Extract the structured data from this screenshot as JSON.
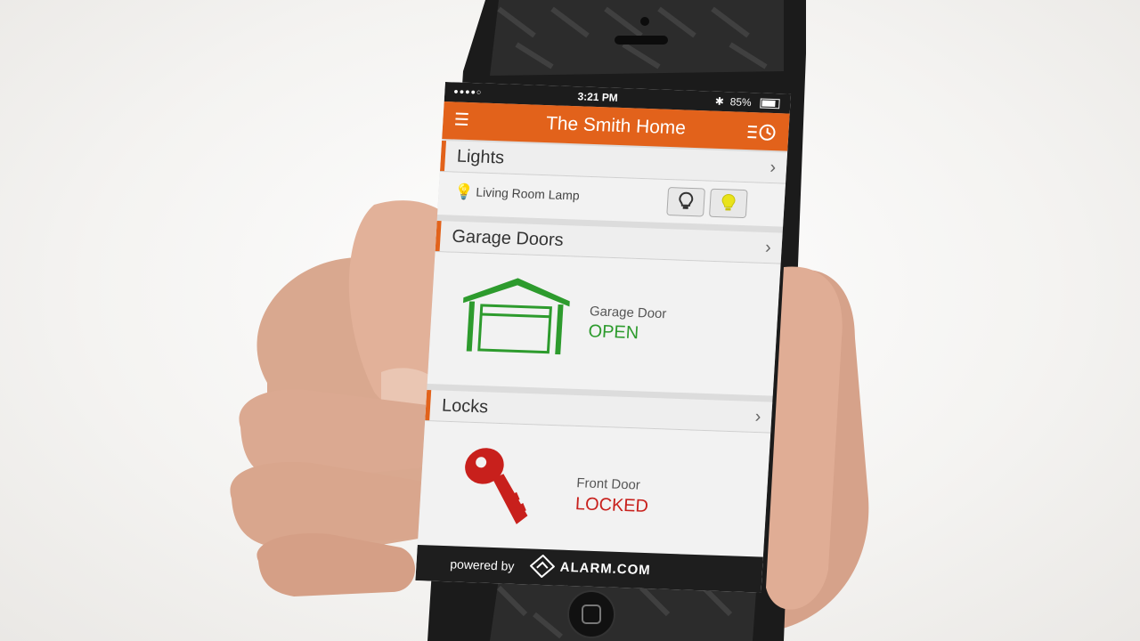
{
  "status_bar": {
    "signal": "●●●●○",
    "time": "3:21 PM",
    "bluetooth": "✱",
    "battery": "85%"
  },
  "header": {
    "title": "The Smith Home",
    "menu_icon": "hamburger-menu-icon",
    "history_icon": "history-clock-icon"
  },
  "lights": {
    "title": "Lights",
    "device_label": "Living Room Lamp",
    "chevron": "›"
  },
  "garage": {
    "title": "Garage Doors",
    "device_label": "Garage Door",
    "status": "OPEN",
    "status_color": "#2d9b2d",
    "chevron": "›"
  },
  "locks": {
    "title": "Locks",
    "device_label": "Front Door",
    "status": "LOCKED",
    "status_color": "#c8201c",
    "chevron": "›"
  },
  "footer": {
    "powered_by": "powered by",
    "brand": "ALARM.COM"
  },
  "colors": {
    "accent": "#e2621b",
    "bulb_on": "#e9e31a"
  }
}
